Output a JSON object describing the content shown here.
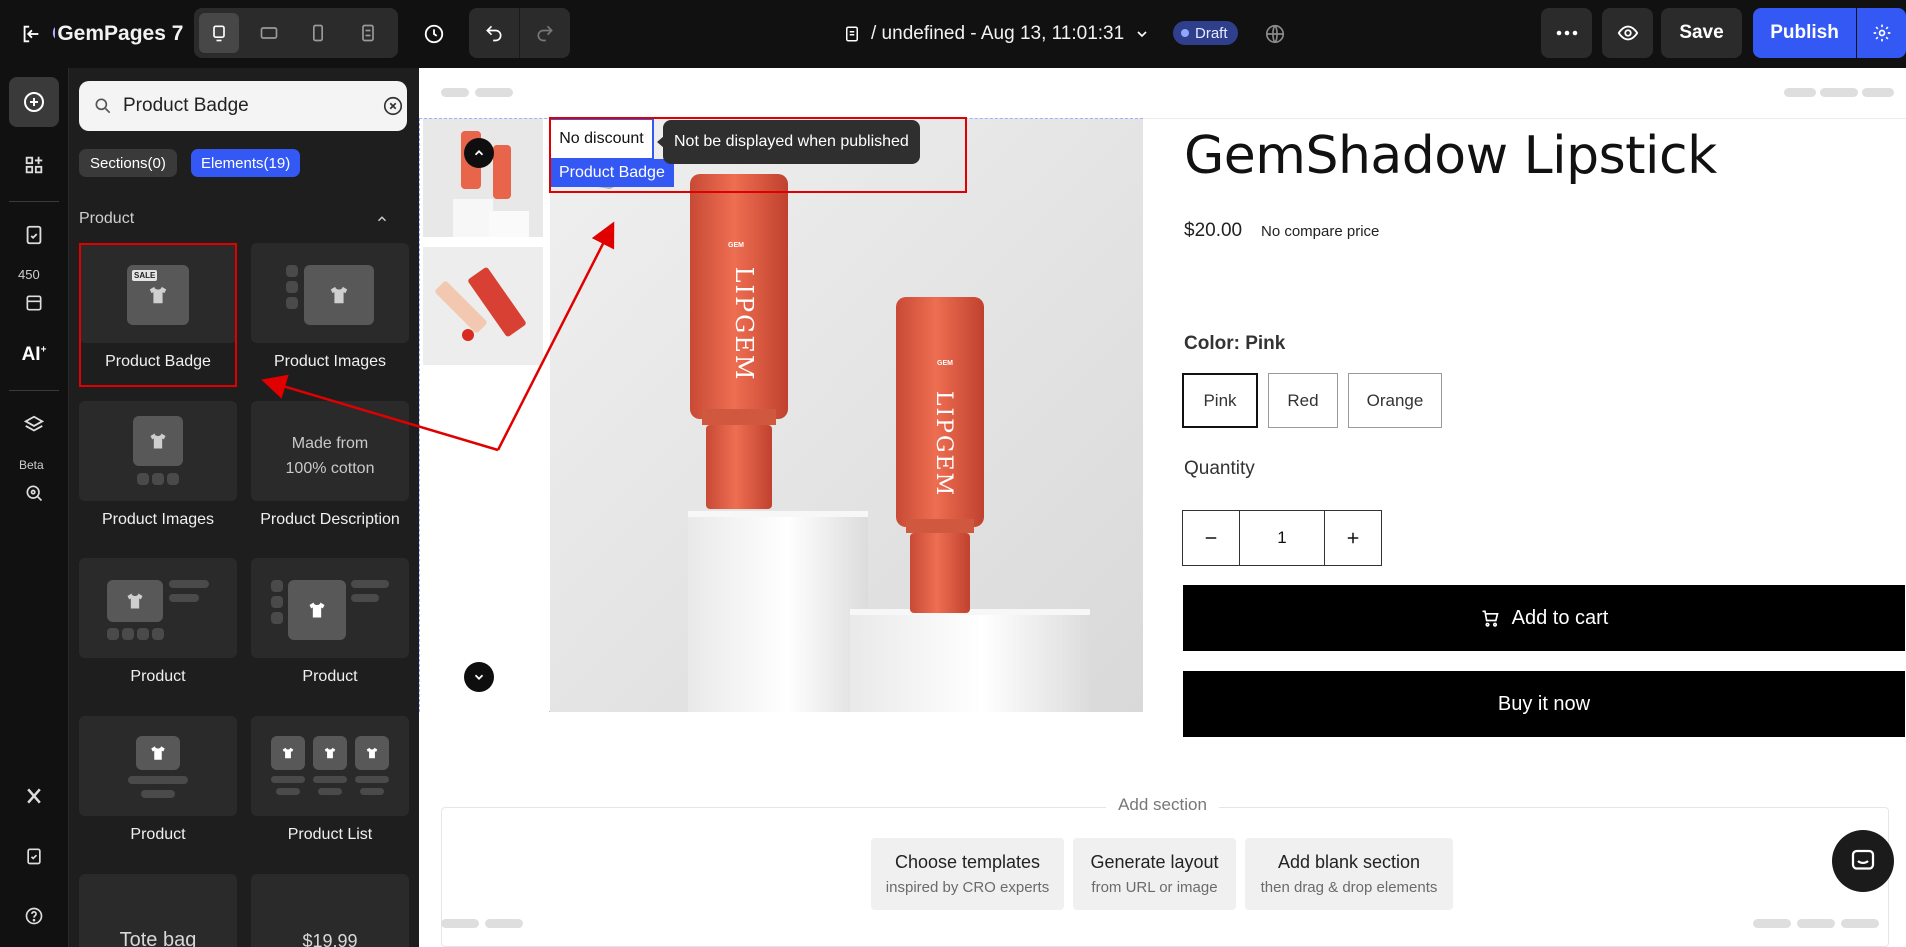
{
  "app": {
    "logo_text": "GemPages 7",
    "page_title": "/ undefined - Aug 13, 11:01:31",
    "status_badge": "Draft",
    "save_label": "Save",
    "publish_label": "Publish"
  },
  "rail": {
    "badge_count": "450",
    "beta_label": "Beta"
  },
  "panel": {
    "search": {
      "value": "Product Badge"
    },
    "tabs": {
      "sections": "Sections(0)",
      "elements": "Elements(19)"
    },
    "category": "Product",
    "elements": [
      {
        "label": "Product Badge",
        "thumb_text": "SALE"
      },
      {
        "label": "Product Images"
      },
      {
        "label": "Product Images"
      },
      {
        "label": "Product Description",
        "thumb_text": "Made from 100% cotton"
      },
      {
        "label": "Product"
      },
      {
        "label": "Product"
      },
      {
        "label": "Product"
      },
      {
        "label": "Product List"
      },
      {
        "thumb_text": "Tote bag"
      },
      {
        "thumb_text": "$19.99"
      }
    ]
  },
  "canvas": {
    "badge": {
      "text": "No discount",
      "tag": "Product Badge",
      "tooltip": "Not be displayed when published"
    },
    "product": {
      "title": "GemShadow Lipstick",
      "price": "$20.00",
      "compare": "No compare price",
      "color_label": "Color: Pink",
      "swatches": [
        "Pink",
        "Red",
        "Orange"
      ],
      "selected_swatch": "Pink",
      "quantity_label": "Quantity",
      "quantity": "1",
      "add_to_cart": "Add to cart",
      "buy_now": "Buy it now"
    },
    "image_text": {
      "brand": "LIPGEM",
      "logo": "GEM"
    },
    "add_section": {
      "label": "Add section",
      "options": [
        {
          "title": "Choose templates",
          "sub": "inspired by CRO experts"
        },
        {
          "title": "Generate layout",
          "sub": "from URL or image"
        },
        {
          "title": "Add blank section",
          "sub": "then drag & drop elements"
        }
      ]
    }
  },
  "colors": {
    "accent": "#3358f4",
    "topbar": "#111111",
    "panel": "#1e1e1e",
    "annotation": "#e00000",
    "product_tube": "#e8644a"
  }
}
